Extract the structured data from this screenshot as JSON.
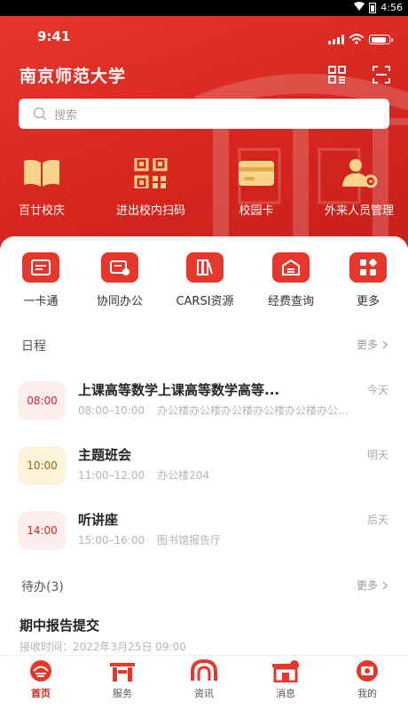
{
  "android_status": {
    "time": "4:56"
  },
  "ios_status": {
    "time": "9:41"
  },
  "header": {
    "title": "南京师范大学"
  },
  "search": {
    "placeholder": "搜索"
  },
  "quick_actions": [
    {
      "label": "百廿校庆",
      "icon": "book-icon"
    },
    {
      "label": "进出校内扫码",
      "icon": "qr-code-icon"
    },
    {
      "label": "校园卡",
      "icon": "card-icon"
    },
    {
      "label": "外来人员管理",
      "icon": "user-gear-icon"
    }
  ],
  "services": [
    {
      "label": "一卡通",
      "icon": "id-card-icon"
    },
    {
      "label": "协同办公",
      "icon": "collab-icon"
    },
    {
      "label": "CARSI资源",
      "icon": "books-icon"
    },
    {
      "label": "经费查询",
      "icon": "fund-icon"
    },
    {
      "label": "更多",
      "icon": "grid-icon"
    }
  ],
  "schedule": {
    "title": "日程",
    "more": "更多",
    "items": [
      {
        "time": "08:00",
        "title": "上课高等数学上课高等数学高等...",
        "range": "08:00–10:00",
        "place": "办公楼办公楼办公楼办公楼办公楼办公...",
        "day": "今天"
      },
      {
        "time": "10:00",
        "title": "主题班会",
        "range": "11:00–12:00",
        "place": "办公楼204",
        "day": "明天"
      },
      {
        "time": "14:00",
        "title": "听讲座",
        "range": "15:00–16:00",
        "place": "图书馆报告厅",
        "day": "后天"
      }
    ]
  },
  "todo": {
    "title": "待办(3)",
    "more": "更多",
    "first": {
      "title": "期中报告提交",
      "received": "接收时间：2022年3月25日 09:00"
    }
  },
  "tabbar": [
    {
      "label": "首页",
      "icon": "home-icon",
      "active": true
    },
    {
      "label": "服务",
      "icon": "service-icon",
      "active": false
    },
    {
      "label": "资讯",
      "icon": "news-icon",
      "active": false
    },
    {
      "label": "消息",
      "icon": "message-icon",
      "active": false,
      "badge": true
    },
    {
      "label": "我的",
      "icon": "profile-icon",
      "active": false
    }
  ],
  "colors": {
    "primary_red": "#e7362b",
    "dark_red": "#c8201a",
    "pill_red_bg": "#fdeeee",
    "pill_yellow_bg": "#fdf3d9",
    "pill_red_text": "#d6261f",
    "pill_yellow_text": "#8a6a10"
  }
}
